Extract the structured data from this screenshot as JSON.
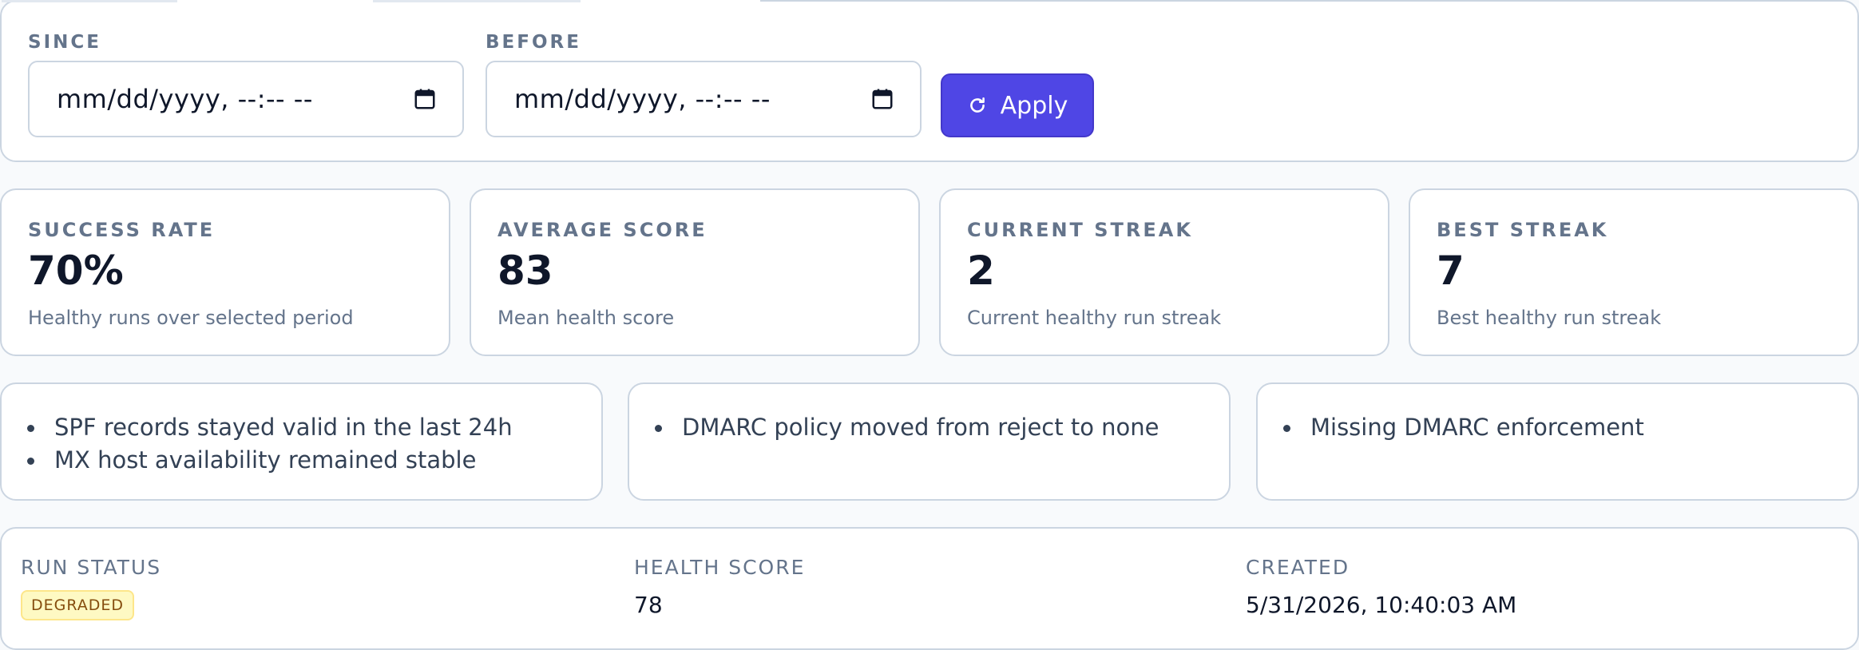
{
  "filters": {
    "since_label": "SINCE",
    "since_placeholder": "mm/dd/yyyy, --:-- --",
    "before_label": "BEFORE",
    "before_placeholder": "mm/dd/yyyy, --:-- --",
    "apply_label": "Apply",
    "accent_color": "#4f46e5"
  },
  "stats": [
    {
      "label": "SUCCESS RATE",
      "value": "70%",
      "description": "Healthy runs over selected period"
    },
    {
      "label": "AVERAGE SCORE",
      "value": "83",
      "description": "Mean health score"
    },
    {
      "label": "CURRENT STREAK",
      "value": "2",
      "description": "Current healthy run streak"
    },
    {
      "label": "BEST STREAK",
      "value": "7",
      "description": "Best healthy run streak"
    }
  ],
  "notes": [
    {
      "items": [
        "SPF records stayed valid in the last 24h",
        "MX host availability remained stable"
      ]
    },
    {
      "items": [
        "DMARC policy moved from reject to none"
      ]
    },
    {
      "items": [
        "Missing DMARC enforcement"
      ]
    }
  ],
  "run": {
    "status_label": "RUN STATUS",
    "status_value": "DEGRADED",
    "status_color": "#854d0e",
    "score_label": "HEALTH SCORE",
    "score_value": "78",
    "created_label": "CREATED",
    "created_value": "5/31/2026, 10:40:03 AM"
  }
}
